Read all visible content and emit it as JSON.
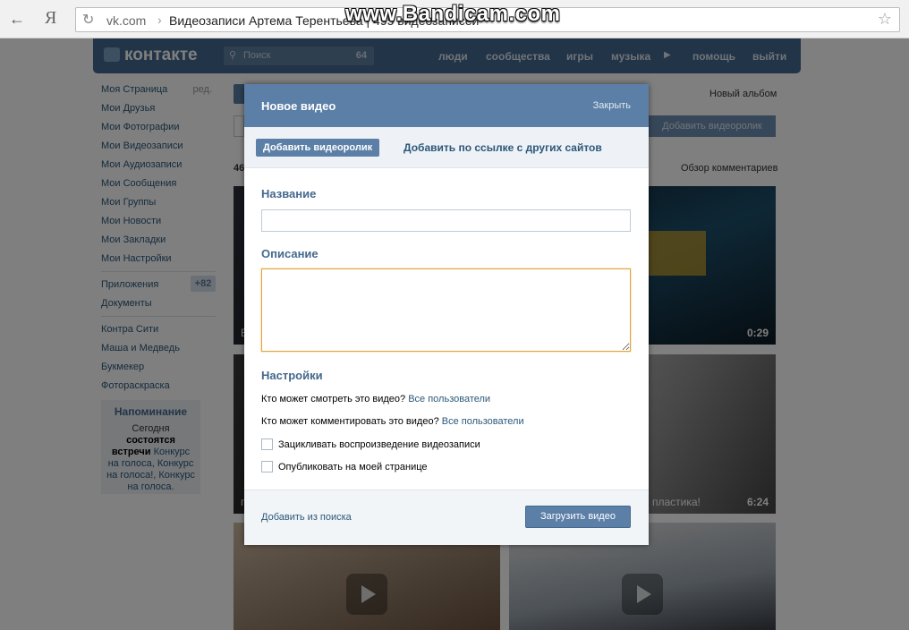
{
  "browser": {
    "back_icon": "←",
    "yandex_button": "Я",
    "url_domain": "vk.com",
    "url_separator": "›",
    "page_title": "Видеозаписи Артема Терентьева | 495 видеозаписей",
    "star_icon": "☆",
    "reload_icon": "↻"
  },
  "watermark": "www.Bandicam.com",
  "vk": {
    "logo": "контакте",
    "search_placeholder": "Поиск",
    "search_count": "64",
    "menu": [
      "люди",
      "сообщества",
      "игры",
      "музыка",
      "помощь",
      "выйти"
    ],
    "music_play_icon": "▶"
  },
  "sidebar": {
    "items": [
      {
        "label": "Моя Страница",
        "edit": "ред."
      },
      {
        "label": "Мои Друзья"
      },
      {
        "label": "Мои Фотографии"
      },
      {
        "label": "Мои Видеозаписи"
      },
      {
        "label": "Мои Аудиозаписи"
      },
      {
        "label": "Мои Сообщения"
      },
      {
        "label": "Мои Группы"
      },
      {
        "label": "Мои Новости"
      },
      {
        "label": "Мои Закладки"
      },
      {
        "label": "Мои Настройки"
      }
    ],
    "apps": {
      "label": "Приложения",
      "badge": "+82"
    },
    "documents": "Документы",
    "extra": [
      "Контра Сити",
      "Маша и Медведь",
      "Букмекер",
      "Фотораскраска"
    ],
    "reminder": {
      "title": "Напоминание",
      "text_pre": "Сегодня ",
      "text_bold": "состоятся встречи",
      "text_links": " Конкурс на голоса, Конкурс на голоса!, Конкурс на голоса."
    }
  },
  "background": {
    "new_album": "Новый альбом",
    "add_video": "Добавить видеоролик",
    "count": "46",
    "overview": "Обзор комментариев",
    "thumbs": [
      {
        "duration": "0:29",
        "caption": "В"
      },
      {
        "duration": "6:24",
        "caption": "пластика!"
      },
      {
        "duration": "",
        "caption": "п"
      }
    ]
  },
  "modal": {
    "title": "Новое видео",
    "close": "Закрыть",
    "tab_upload": "Добавить видеоролик",
    "tab_link": "Добавить по ссылке с других сайтов",
    "name_label": "Название",
    "name_value": "",
    "description_label": "Описание",
    "description_value": "",
    "settings_title": "Настройки",
    "who_view_text": "Кто может смотреть это видео?",
    "who_view_value": "Все пользователи",
    "who_comment_text": "Кто может комментировать это видео?",
    "who_comment_value": "Все пользователи",
    "loop_label": "Зацикливать воспроизведение видеозаписи",
    "publish_label": "Опубликовать на моей странице",
    "add_from_search": "Добавить из поиска",
    "upload_button": "Загрузить видео"
  }
}
